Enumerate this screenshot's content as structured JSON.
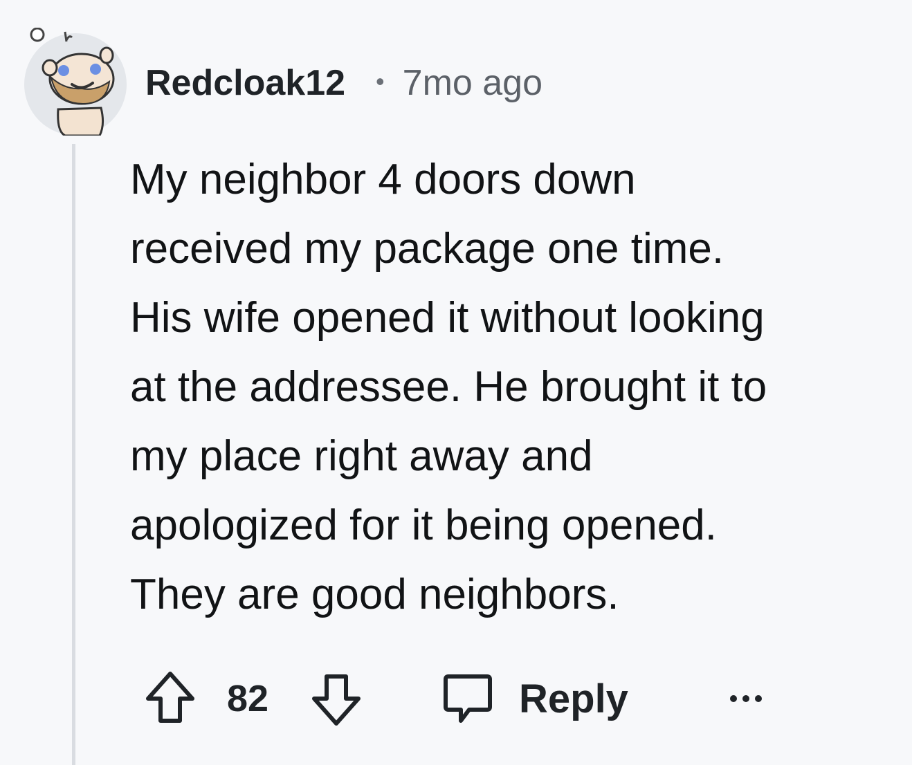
{
  "comment": {
    "username": "Redcloak12",
    "separator": "•",
    "timestamp": "7mo ago",
    "body_lines": [
      "My neighbor 4 doors down",
      "received my package one time.",
      "His wife opened it without looking",
      "at the addressee. He brought it to",
      "my place right away and",
      "apologized for it being opened.",
      "They are good neighbors."
    ]
  },
  "actions": {
    "score": "82",
    "reply_label": "Reply",
    "upvote_icon": "upvote-arrow-icon",
    "downvote_icon": "downvote-arrow-icon",
    "reply_icon": "speech-bubble-icon",
    "more_icon": "more-options-icon"
  },
  "colors": {
    "background": "#f7f8fa",
    "thread_line": "#d9dce1",
    "text": "#111315",
    "meta_text": "#5c6168"
  }
}
